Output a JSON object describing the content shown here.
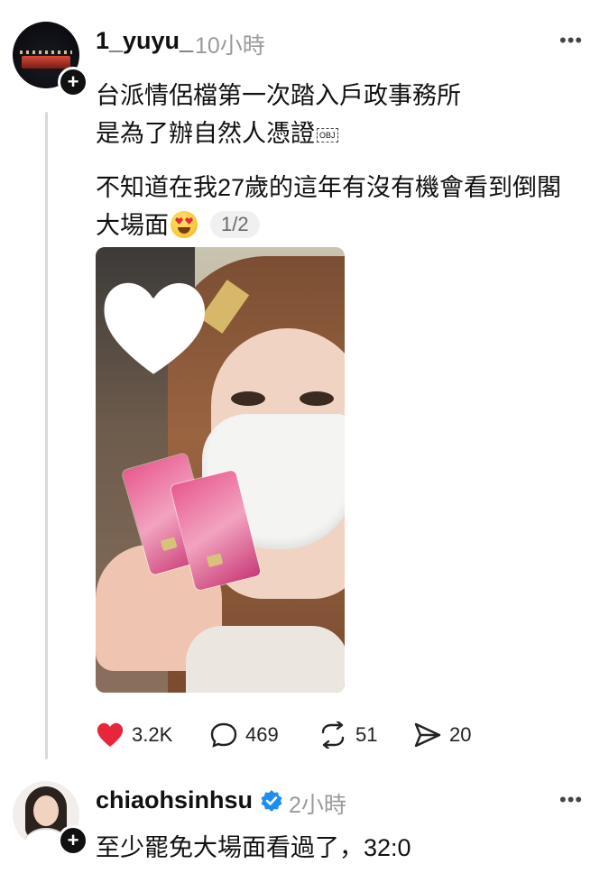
{
  "post": {
    "username": "1_yuyu_",
    "time": "10小時",
    "more": "•••",
    "line1": "台派情侶檔第一次踏入戶政事務所",
    "line2": "是為了辦自然人憑證",
    "obj_tag": "OBJ",
    "line3": "不知道在我27歲的這年有沒有機會看到倒閣",
    "line4": "大場面",
    "emoji": "heart-eyes-emoji",
    "image_counter": "1/2",
    "likes": "3.2K",
    "comments": "469",
    "reposts": "51",
    "shares": "20",
    "colors": {
      "like_red": "#e8263b",
      "thread_line": "#d9d9d9",
      "time_gray": "#9a9a9a"
    }
  },
  "reply": {
    "username": "chiaohsinhsu",
    "verified": true,
    "time": "2小時",
    "more": "•••",
    "text": "至少罷免大場面看過了，32:0",
    "colors": {
      "verified_blue": "#1d8ef0"
    }
  }
}
